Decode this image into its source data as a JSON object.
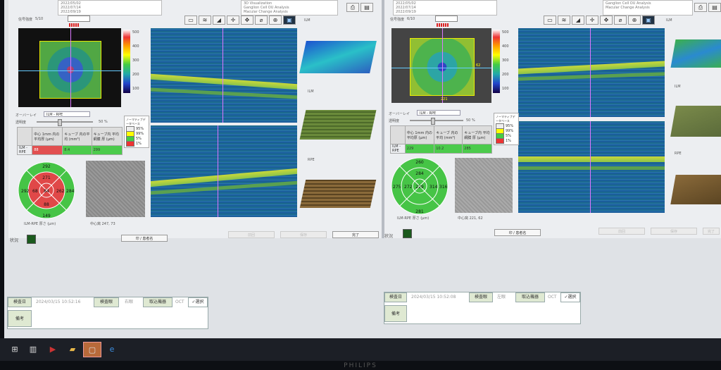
{
  "left": {
    "dates": [
      "2022/05/02",
      "2022/07/14",
      "2022/09/19"
    ],
    "analyses": [
      "3D Visualization",
      "Ganglion Cell OU Analysis",
      "Macular Change Analysis"
    ],
    "signal_label": "信号強度",
    "signal_value": "5/10",
    "overlay_label": "オーバーレイ",
    "overlay_value": "ILM - RPE",
    "transparency_label": "透明度",
    "transparency_value": "50 %",
    "colorbar_ticks": [
      "500",
      "400",
      "300",
      "200",
      "100",
      "0 μm"
    ],
    "legend_title": "ノーマティブデータベース",
    "legend_items": [
      "95%",
      "99%",
      "5%",
      "1%"
    ],
    "table_headers": [
      "",
      "中心 1mm 内の平均厚 (μm)",
      "キューブ 内の平均 (mm³)",
      "キューブ内 平均網膜 厚 (μm)"
    ],
    "table_row": [
      "ILM - RPE",
      "88",
      "8.4",
      "299"
    ],
    "thickness_map_values": [
      "292",
      "271",
      "292",
      "68",
      "84",
      "262",
      "284",
      "88",
      "149"
    ],
    "thickness_map_caption": "ILM-RPE 厚さ (μm)",
    "fovea_caption": "中心窩 247, 73",
    "oct_labels": [
      "ILM",
      "RPE"
    ],
    "buttons": [
      "印 / 患者名",
      "前回",
      "保存",
      "完了"
    ],
    "status_label": "状況",
    "form": {
      "exam_date_label": "検査日",
      "exam_date_value": "2024/03/15 10:52:16",
      "eye_label": "検査眼",
      "eye_value": "右眼",
      "device_label": "取込機器",
      "device_value": "OCT",
      "select_label": "選択",
      "note_label": "備考"
    }
  },
  "right": {
    "dates": [
      "2022/05/02",
      "2022/07/14",
      "2022/09/19"
    ],
    "analyses": [
      "Ganglion Cell OU Analysis",
      "Macular Change Analysis"
    ],
    "signal_label": "信号強度",
    "signal_value": "6/10",
    "overlay_label": "オーバーレイ",
    "overlay_value": "ILM - RPE",
    "transparency_label": "透明度",
    "transparency_value": "50 %",
    "colorbar_ticks": [
      "500",
      "400",
      "300",
      "200",
      "100",
      "0 μm"
    ],
    "legend_title": "ノーマティブデータベース",
    "legend_items": [
      "95%",
      "99%",
      "5%",
      "1%"
    ],
    "table_headers": [
      "",
      "中心 1mm 内の平均厚 (μm)",
      "キューブ 内の平均 (mm³)",
      "キューブ内 平均網膜 厚 (μm)"
    ],
    "table_row": [
      "ILM - RPE",
      "229",
      "10.2",
      "285"
    ],
    "thickness_map_values": [
      "260",
      "284",
      "275",
      "272",
      "314",
      "316",
      "229",
      "281"
    ],
    "thickness_map_caption": "ILM-RPE 厚さ (μm)",
    "fovea_caption": "中心窩 221, 62",
    "fundus_labels": [
      "62",
      "221"
    ],
    "oct_labels": [
      "ILM",
      "RPE"
    ],
    "buttons": [
      "印 / 患者名",
      "前回",
      "保存",
      "完了"
    ],
    "status_label": "状況",
    "form": {
      "exam_date_label": "検査日",
      "exam_date_value": "2024/03/15 10:52:08",
      "eye_label": "検査眼",
      "eye_value": "左眼",
      "device_label": "取込機器",
      "device_value": "OCT",
      "select_label": "選択",
      "note_label": "備考"
    }
  },
  "monitor_brand": "PHILIPS"
}
